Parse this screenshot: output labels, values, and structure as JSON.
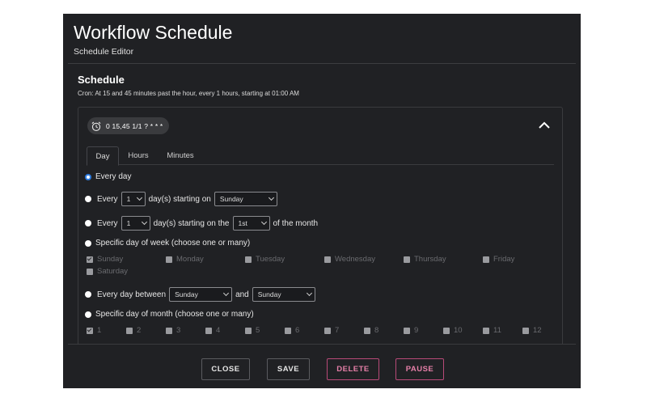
{
  "header": {
    "title": "Workflow Schedule",
    "subtitle": "Schedule Editor"
  },
  "schedule": {
    "title": "Schedule",
    "cron_description": "Cron: At 15 and 45 minutes past the hour, every 1 hours, starting at 01:00 AM",
    "cron_expression": "0 15,45 1/1 ? * * *",
    "chip_icon": "alarm-clock-icon",
    "collapse_icon": "chevron-up-icon"
  },
  "tabs": [
    {
      "label": "Day",
      "active": true
    },
    {
      "label": "Hours",
      "active": false
    },
    {
      "label": "Minutes",
      "active": false
    }
  ],
  "options": {
    "every_day": "Every day",
    "every_n_days": {
      "prefix": "Every",
      "interval": "1",
      "mid": "day(s) starting on",
      "start_day": "Sunday"
    },
    "every_n_days_month": {
      "prefix": "Every",
      "interval": "1",
      "mid": "day(s) starting on the",
      "start_date": "1st",
      "suffix": "of the month"
    },
    "specific_week": "Specific day of week (choose one or many)",
    "weekdays": [
      "Sunday",
      "Monday",
      "Tuesday",
      "Wednesday",
      "Thursday",
      "Friday",
      "Saturday"
    ],
    "between": {
      "prefix": "Every day between",
      "from": "Sunday",
      "and": "and",
      "to": "Sunday"
    },
    "specific_month": "Specific day of month (choose one or many)",
    "month_days": [
      "1",
      "2",
      "3",
      "4",
      "5",
      "6",
      "7",
      "8",
      "9",
      "10",
      "11",
      "12"
    ]
  },
  "footer": {
    "close": "CLOSE",
    "save": "SAVE",
    "delete": "DELETE",
    "pause": "PAUSE"
  },
  "colors": {
    "modal_bg": "#202124",
    "selected_radio": "#2f7de1",
    "danger": "#e57fa8"
  }
}
